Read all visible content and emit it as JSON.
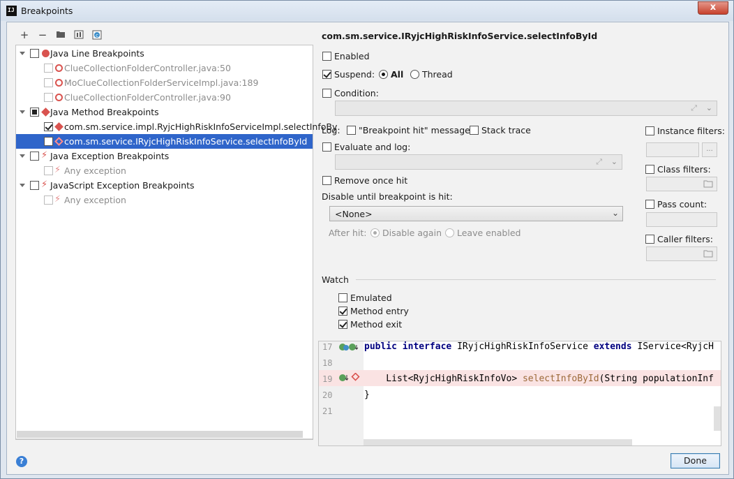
{
  "window": {
    "title": "Breakpoints",
    "close_label": "x",
    "app_icon_text": "IJ"
  },
  "toolbar": {
    "add": "+",
    "remove": "−"
  },
  "tree": {
    "groups": [
      {
        "label": "Java Line Breakpoints",
        "items": [
          "ClueCollectionFolderController.java:50",
          "MoClueCollectionFolderServiceImpl.java:189",
          "ClueCollectionFolderController.java:90"
        ]
      },
      {
        "label": "Java Method Breakpoints",
        "items": [
          "com.sm.service.impl.RyjcHighRiskInfoServiceImpl.selectInfoBy",
          "com.sm.service.IRyjcHighRiskInfoService.selectInfoById"
        ]
      },
      {
        "label": "Java Exception Breakpoints",
        "items": [
          "Any exception"
        ]
      },
      {
        "label": "JavaScript Exception Breakpoints",
        "items": [
          "Any exception"
        ]
      }
    ]
  },
  "details": {
    "heading": "com.sm.service.IRyjcHighRiskInfoService.selectInfoById",
    "enabled": "Enabled",
    "suspend": "Suspend:",
    "suspend_all": "All",
    "suspend_thread": "Thread",
    "condition": "Condition:",
    "log": "Log:",
    "log_message": "\"Breakpoint hit\" message",
    "stack_trace": "Stack trace",
    "evaluate": "Evaluate and log:",
    "remove_once_hit": "Remove once hit",
    "disable_until": "Disable until breakpoint is hit:",
    "none_option": "<None>",
    "after_hit": "After hit:",
    "disable_again": "Disable again",
    "leave_enabled": "Leave enabled",
    "instance_filters": "Instance filters:",
    "instance_browse": "...",
    "class_filters": "Class filters:",
    "pass_count": "Pass count:",
    "caller_filters": "Caller filters:",
    "watch": "Watch",
    "emulated": "Emulated",
    "method_entry": "Method entry",
    "method_exit": "Method exit"
  },
  "editor": {
    "line_numbers": [
      "17",
      "18",
      "19",
      "20",
      "21"
    ],
    "line17": {
      "kw1": "public",
      "kw2": "interface",
      "name": " IRyjcHighRiskInfoService ",
      "kw3": "extends",
      "rest": " IService<RyjcH"
    },
    "line19": {
      "pre": "    List<RyjcHighRiskInfoVo> ",
      "method": "selectInfoById",
      "post": "(String populationInf"
    },
    "line20": "}"
  },
  "footer": {
    "help": "?",
    "done": "Done"
  },
  "colors": {
    "selection": "#2f65ca",
    "breakpoint_red": "#d9534f",
    "line_highlight": "#fae3e3"
  }
}
